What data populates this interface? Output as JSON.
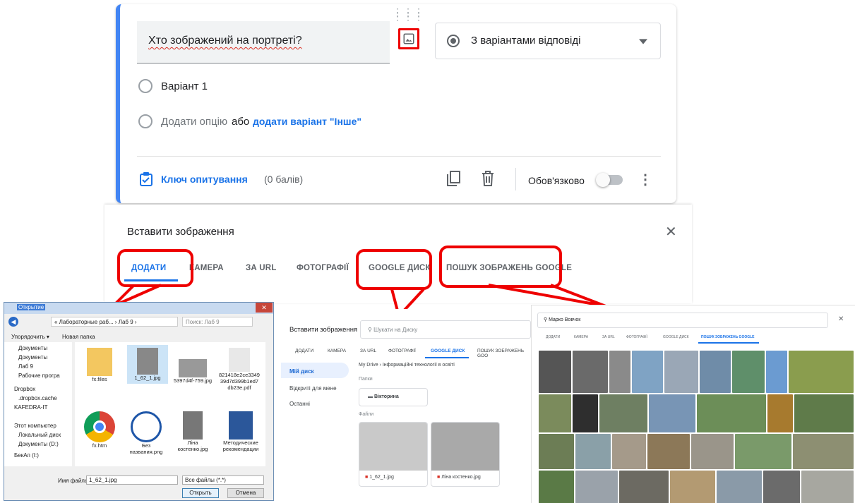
{
  "question": {
    "title": "Хто зображений на портреті?",
    "type": "З варіантами відповіді",
    "option1": "Варіант 1",
    "add_option": "Додати опцію",
    "or": "або",
    "add_other": "додати варіант \"Інше\"",
    "answer_key": "Ключ опитування",
    "points": "(0 балів)",
    "required": "Обов'язково"
  },
  "insert_dialog": {
    "title": "Вставити зображення",
    "tabs": [
      "ДОДАТИ",
      "КАМЕРА",
      "ЗА URL",
      "ФОТОГРАФІЇ",
      "GOOGLE ДИСК",
      "ПОШУК ЗОБРАЖЕНЬ GOOGLE"
    ]
  },
  "explorer": {
    "title": "Открытие",
    "path": "« Лабораторные раб... › Лаб 9 ›",
    "search_placeholder": "Поиск: Лаб 9",
    "organize": "Упорядочить ▾",
    "new_folder": "Новая папка",
    "sidebar": [
      "Документы",
      "Документы",
      "Лаб 9",
      "Рабочие програ",
      "Dropbox",
      ".dropbox.cache",
      "KAFEDRA-IT",
      "Этот компьютер",
      "Локальный диск",
      "Документы (D:)",
      "БекАп (I:)"
    ],
    "files": [
      "fx.files",
      "1_62_1.jpg",
      "5397d4f-759.jpg",
      "821418e2ce3349 39d7d399b1ed7 db23e.pdf",
      "fx.htm",
      "Без названия.png",
      "Ліна костенко.jpg",
      "Методические рекомендации"
    ],
    "filename_label": "Имя файла:",
    "filename_value": "1_62_1.jpg",
    "filetype": "Все файлы (*.*)",
    "open": "Открыть",
    "cancel": "Отмена"
  },
  "drive": {
    "title": "Вставити зображення",
    "search_placeholder": "Шукати на Диску",
    "tabs": [
      "ДОДАТИ",
      "КАМЕРА",
      "ЗА URL",
      "ФОТОГРАФІЇ",
      "GOOGLE ДИСК",
      "ПОШУК ЗОБРАЖЕНЬ GOO"
    ],
    "nav": [
      "Мій диск",
      "Відкриті для мене",
      "Останні"
    ],
    "breadcrumb": "My Drive  ›  Інформаційні технології в освіті",
    "folders_label": "Папки",
    "folder": "Вікторина",
    "files_label": "Файли",
    "files": [
      "1_62_1.jpg",
      "Ліна костенко.jpg"
    ]
  },
  "gsearch": {
    "query": "Марко Вовчок",
    "tabs": [
      "ДОДАТИ",
      "КАМЕРА",
      "ЗА URL",
      "ФОТОГРАФІЇ",
      "GOOGLE ДИСК",
      "ПОШУК ЗОБРАЖЕНЬ GOOGLE"
    ]
  },
  "colors": {
    "accent": "#1a73e8",
    "callout": "#e00000",
    "card_accent": "#4285f4"
  }
}
